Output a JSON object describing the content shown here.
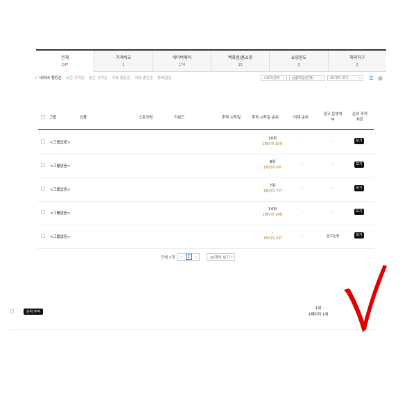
{
  "tabs": [
    {
      "label": "전체",
      "count": "247"
    },
    {
      "label": "가격비교",
      "count": "1"
    },
    {
      "label": "네이버페이",
      "count": "174"
    },
    {
      "label": "백화점/홈쇼핑",
      "count": "15"
    },
    {
      "label": "쇼핑윈도",
      "count": "0"
    },
    {
      "label": "해외직구",
      "count": "0"
    }
  ],
  "sort": {
    "options": [
      "네이버 랭킹순",
      "낮은 가격순",
      "높은 가격순",
      "리뷰 많은순",
      "리뷰 좋은순",
      "등록일순"
    ],
    "active_index": 0
  },
  "filters": {
    "shipping": "스토어선택",
    "display_type": "상품타입(전체)",
    "per_page": "40개씩 보기"
  },
  "table": {
    "headers": {
      "group": "그룹",
      "product": "상품",
      "store": "스토어명",
      "keyword": "키워드",
      "track_start": "추적 시작일",
      "track_rank": "추적 시작일 순위",
      "today_rank": "어제 순위",
      "ad": "광고 운영여부",
      "rank_history": "순위 추적차트"
    },
    "rows": [
      {
        "group": "<그룹없음>",
        "rank": "10위",
        "page_pos": "1페이지 10위",
        "ad": "-",
        "action": "보기"
      },
      {
        "group": "<그룹없음>",
        "rank": "8위",
        "page_pos": "1페이지 8위",
        "ad": "-",
        "action": "보기"
      },
      {
        "group": "<그룹없음>",
        "rank": "7위",
        "page_pos": "1페이지 7위",
        "ad": "-",
        "action": "보기"
      },
      {
        "group": "<그룹없음>",
        "rank": "14위",
        "page_pos": "1페이지 14위",
        "ad": "-",
        "action": "보기"
      },
      {
        "group": "<그룹없음>",
        "rank": "-",
        "page_pos": "1페이지 4위",
        "ad": "광고운영",
        "action": "보기"
      }
    ]
  },
  "pagination": {
    "total": "전체 5개",
    "prev": "‹",
    "current": "1",
    "next": "›",
    "per_page": "10개씩 보기"
  },
  "overlay": {
    "pill": "순위 추적",
    "rank": "1위",
    "page_pos": "1페이지 1위",
    "check_color": "#e00000"
  },
  "colors": {
    "active_count": "#e02020",
    "page_highlight": "#2a7ad5",
    "page_pos": "#b07a30"
  }
}
